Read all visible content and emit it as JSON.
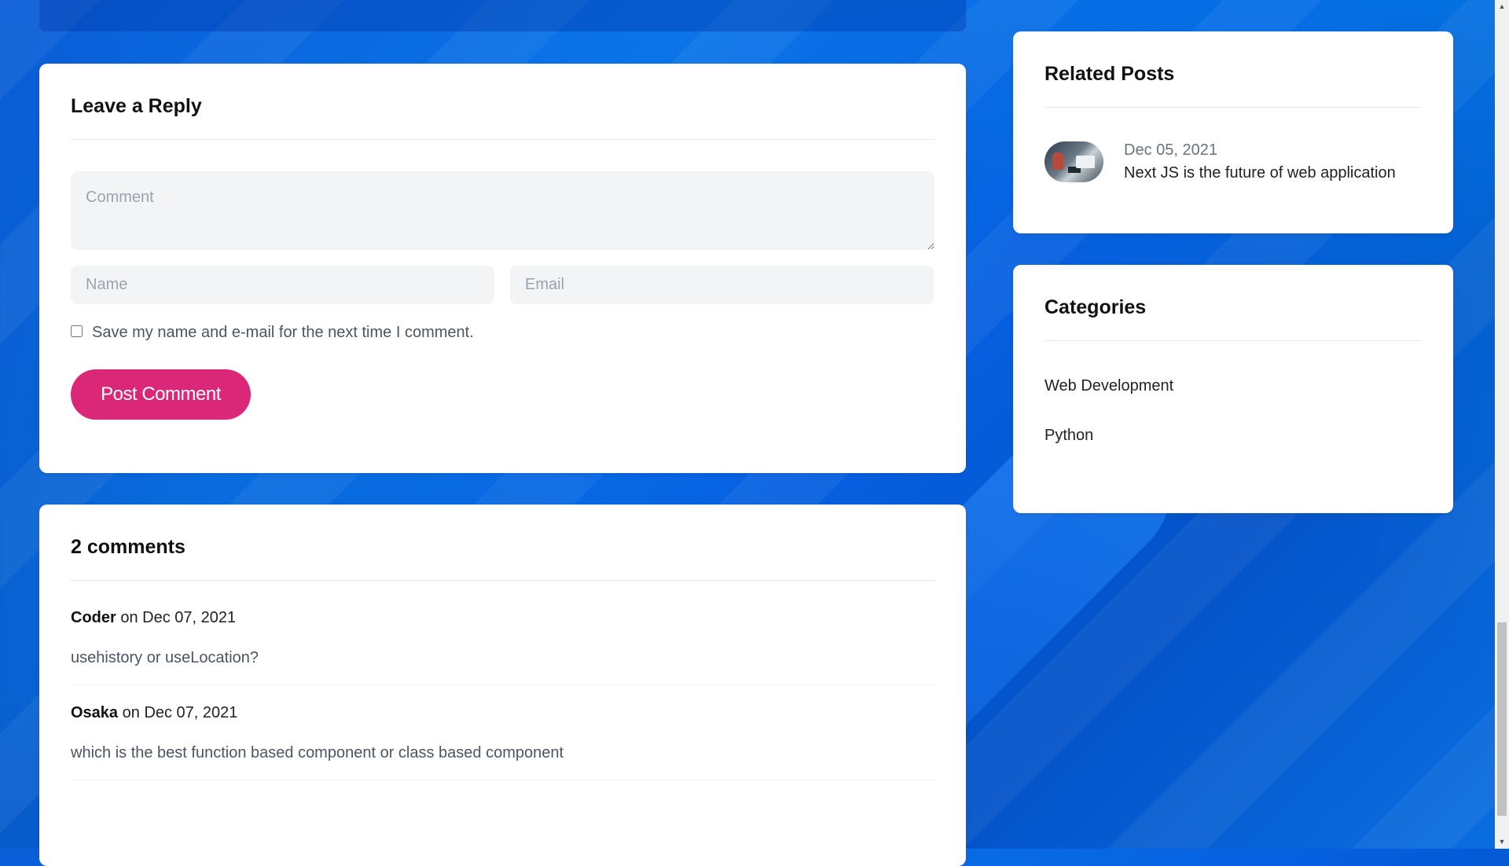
{
  "reply": {
    "title": "Leave a Reply",
    "comment_placeholder": "Comment",
    "name_placeholder": "Name",
    "email_placeholder": "Email",
    "save_label": "Save my name and e-mail for the next time I comment.",
    "submit_label": "Post Comment"
  },
  "comments": {
    "title": "2 comments",
    "items": [
      {
        "author": "Coder",
        "on": "on",
        "date": "Dec 07, 2021",
        "text": "usehistory or useLocation?"
      },
      {
        "author": "Osaka",
        "on": "on",
        "date": "Dec 07, 2021",
        "text": "which is the best function based component or class based component"
      }
    ]
  },
  "related": {
    "title": "Related Posts",
    "items": [
      {
        "date": "Dec 05, 2021",
        "title": "Next JS is the future of web application"
      }
    ]
  },
  "categories": {
    "title": "Categories",
    "items": [
      "Web Development",
      "Python"
    ]
  },
  "colors": {
    "accent": "#db2777",
    "background": "#0a64e0"
  }
}
